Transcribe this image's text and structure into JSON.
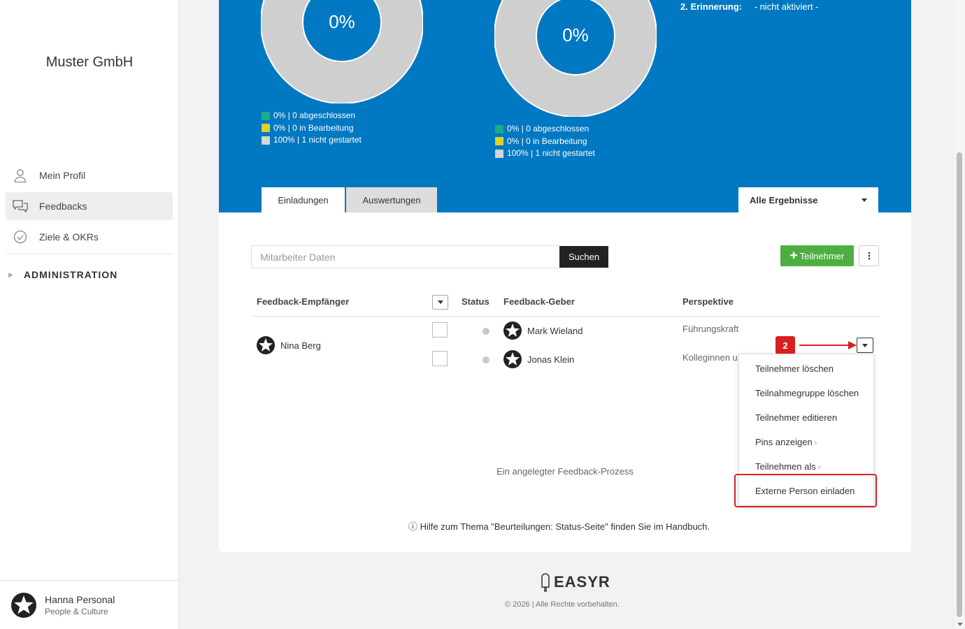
{
  "sidebar": {
    "company": "Muster GmbH",
    "items": [
      {
        "label": "Mein Profil",
        "icon": "user-icon"
      },
      {
        "label": "Feedbacks",
        "icon": "chat-icon"
      },
      {
        "label": "Ziele & OKRs",
        "icon": "check-circle-icon"
      }
    ],
    "admin_label": "ADMINISTRATION",
    "user": {
      "name": "Hanna Personal",
      "role": "People & Culture"
    }
  },
  "stats": {
    "donut1": {
      "label": "0%",
      "legend": [
        "0% | 0 abgeschlossen",
        "0% | 0 in Bearbeitung",
        "100% | 1 nicht gestartet"
      ]
    },
    "donut2": {
      "label": "0%",
      "legend": [
        "0% | 0 abgeschlossen",
        "0% | 0 in Bearbeitung",
        "100% | 1 nicht gestartet"
      ]
    },
    "legend_colors": [
      "#1aab8a",
      "#e0d02a",
      "#d6d6d6"
    ],
    "reminder": {
      "label": "2. Erinnerung:",
      "value": "- nicht aktiviert -"
    }
  },
  "tabs": [
    {
      "label": "Einladungen",
      "active": true
    },
    {
      "label": "Auswertungen",
      "active": false
    }
  ],
  "filter": {
    "selected": "Alle Ergebnisse"
  },
  "search": {
    "placeholder": "Mitarbeiter Daten",
    "button": "Suchen"
  },
  "actions": {
    "add_label": "Teilnehmer"
  },
  "table": {
    "headers": [
      "Feedback-Empfänger",
      "Status",
      "Feedback-Geber",
      "Perspektive"
    ],
    "recipient": "Nina Berg",
    "rows": [
      {
        "giver": "Mark Wieland",
        "perspective": "Führungskraft"
      },
      {
        "giver": "Jonas Klein",
        "perspective": "Kolleginnen u"
      }
    ]
  },
  "annotation": {
    "badge": "2"
  },
  "menu": [
    {
      "label": "Teilnehmer löschen",
      "submenu": false
    },
    {
      "label": "Teilnahmegruppe löschen",
      "submenu": false
    },
    {
      "label": "Teilnehmer editieren",
      "submenu": false
    },
    {
      "label": "Pins anzeigen",
      "submenu": true
    },
    {
      "label": "Teilnehmen als",
      "submenu": true
    },
    {
      "label": "Externe Person einladen",
      "submenu": false
    }
  ],
  "footer": {
    "count": "Ein angelegter Feedback-Prozess",
    "help": "Hilfe zum Thema \"Beurteilungen: Status-Seite\" finden Sie im Handbuch.",
    "logo": "EASYR",
    "copyright": "© 2026 | Alle Rechte vorbehalten."
  }
}
